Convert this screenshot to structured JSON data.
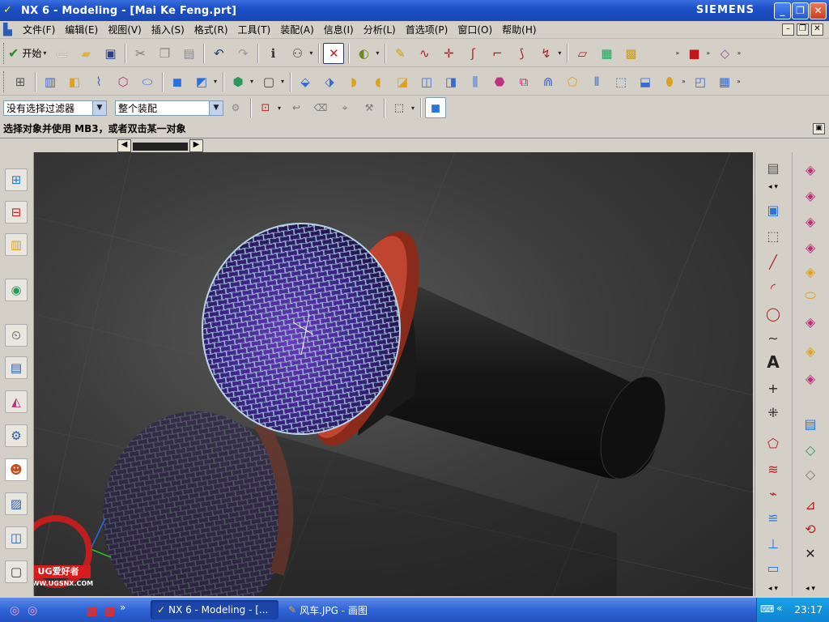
{
  "window": {
    "title": "NX 6 - Modeling - [Mai Ke Feng.prt]",
    "brand": "SIEMENS",
    "minimize": "_",
    "maximize": "❐",
    "close": "✕"
  },
  "menubar": {
    "items": [
      "文件(F)",
      "编辑(E)",
      "视图(V)",
      "插入(S)",
      "格式(R)",
      "工具(T)",
      "装配(A)",
      "信息(I)",
      "分析(L)",
      "首选项(P)",
      "窗口(O)",
      "帮助(H)"
    ]
  },
  "toolbar": {
    "start_label": "开始"
  },
  "filterbar": {
    "selection_filter": "没有选择过滤器",
    "assembly_scope": "整个装配"
  },
  "status": {
    "prompt": "选择对象并使用 MB3，或者双击某一对象"
  },
  "watermark": {
    "text": "UG爱好者",
    "url": "WWW.UGSNX.COM"
  },
  "taskbar": {
    "nx_task": "NX 6 - Modeling - [...",
    "paint_task": "风车.JPG - 画图",
    "clock": "23:17"
  },
  "icons": {
    "titlebar": "nx-logo-icon",
    "start": "nx-start-icon"
  },
  "colors": {
    "titlebar": "#1c4fc4",
    "viewport_bg": "#3c3c3c",
    "mic_ring": "#b03a28",
    "mic_mesh": "#9ec0d8",
    "mic_capsule": "#4a2a8a",
    "taskbar": "#2f64d6"
  }
}
